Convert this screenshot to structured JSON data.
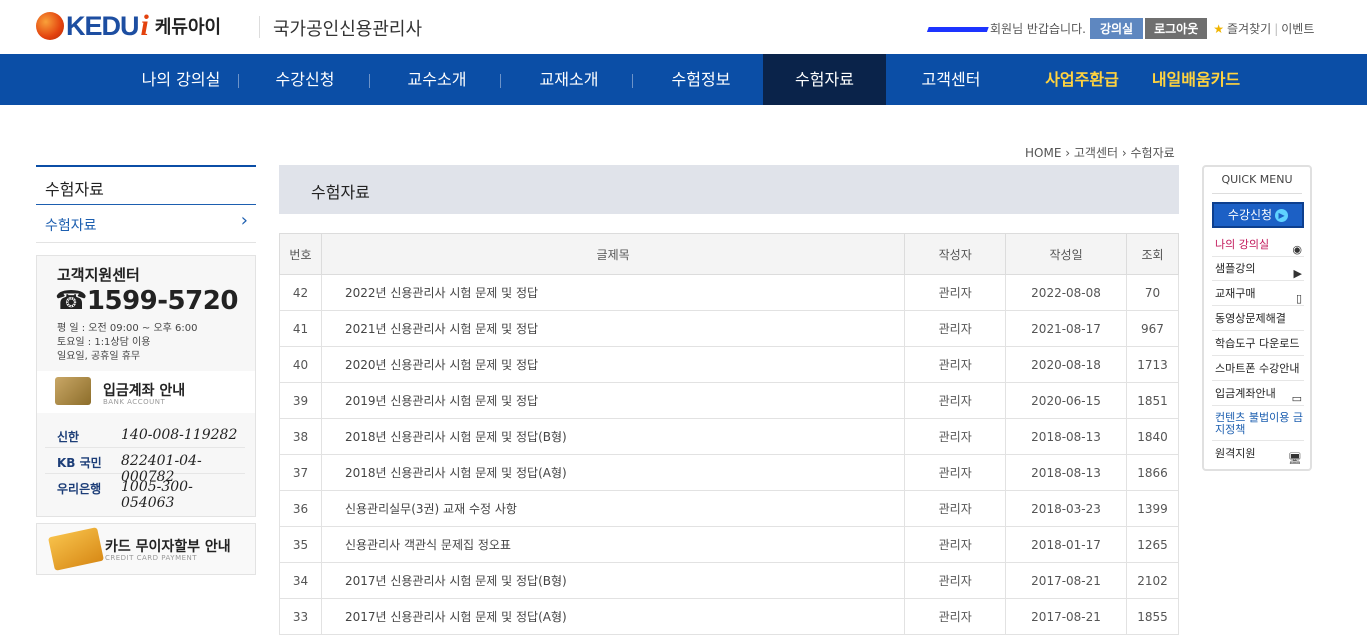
{
  "header": {
    "logo_text": "KEDU",
    "logo_i": "i",
    "logo_kr": "케듀아이",
    "site_subtitle": "국가공인신용관리사",
    "greeting": "회원님 반갑습니다.",
    "classroom_btn": "강의실",
    "logout_btn": "로그아웃",
    "bookmark": "즐겨찾기",
    "event": "이벤트"
  },
  "nav": {
    "items": [
      "나의 강의실",
      "수강신청",
      "교수소개",
      "교재소개",
      "수험정보",
      "수험자료",
      "고객센터",
      "사업주환급",
      "내일배움카드"
    ],
    "active_index": 5
  },
  "breadcrumb": [
    "HOME",
    "고객센터",
    "수험자료"
  ],
  "sidebar": {
    "title": "수험자료",
    "items": [
      {
        "label": "수험자료"
      }
    ],
    "cs_title": "고객지원센터",
    "cs_phone": "☎1599-5720",
    "cs_hours": [
      "평  일  :  오전 09:00 ~ 오후 6:00",
      "토요일  :  1:1상담 이용",
      "일요일, 공휴일 휴무"
    ],
    "bank_title": "입금계좌 안내",
    "bank_sub": "BANK ACCOUNT",
    "banks": [
      {
        "name": "신한",
        "account": "140-008-119282"
      },
      {
        "name": "KB 국민",
        "account": "822401-04-000782"
      },
      {
        "name": "우리은행",
        "account": "1005-300-054063"
      }
    ],
    "card_title": "카드 무이자할부 안내",
    "card_sub": "CREDIT CARD PAYMENT"
  },
  "content": {
    "title": "수험자료",
    "columns": [
      "번호",
      "글제목",
      "작성자",
      "작성일",
      "조회"
    ],
    "rows": [
      {
        "no": "42",
        "subject": "2022년 신용관리사 시험 문제 및 정답",
        "author": "관리자",
        "date": "2022-08-08",
        "views": "70"
      },
      {
        "no": "41",
        "subject": "2021년 신용관리사 시험 문제 및 정답",
        "author": "관리자",
        "date": "2021-08-17",
        "views": "967"
      },
      {
        "no": "40",
        "subject": "2020년 신용관리사 시험 문제 및 정답",
        "author": "관리자",
        "date": "2020-08-18",
        "views": "1713"
      },
      {
        "no": "39",
        "subject": "2019년 신용관리사 시험 문제 및 정답",
        "author": "관리자",
        "date": "2020-06-15",
        "views": "1851"
      },
      {
        "no": "38",
        "subject": "2018년 신용관리사 시험 문제 및 정답(B형)",
        "author": "관리자",
        "date": "2018-08-13",
        "views": "1840"
      },
      {
        "no": "37",
        "subject": "2018년 신용관리사 시험 문제 및 정답(A형)",
        "author": "관리자",
        "date": "2018-08-13",
        "views": "1866"
      },
      {
        "no": "36",
        "subject": "신용관리실무(3권) 교재 수정 사항",
        "author": "관리자",
        "date": "2018-03-23",
        "views": "1399"
      },
      {
        "no": "35",
        "subject": "신용관리사 객관식 문제집 정오표",
        "author": "관리자",
        "date": "2018-01-17",
        "views": "1265"
      },
      {
        "no": "34",
        "subject": "2017년 신용관리사 시험 문제 및 정답(B형)",
        "author": "관리자",
        "date": "2017-08-21",
        "views": "2102"
      },
      {
        "no": "33",
        "subject": "2017년 신용관리사 시험 문제 및 정답(A형)",
        "author": "관리자",
        "date": "2017-08-21",
        "views": "1855"
      }
    ]
  },
  "quick_menu": {
    "title": "QUICK MENU",
    "button": "수강신청",
    "items": [
      {
        "label": "나의 강의실",
        "icon": "user-icon",
        "glyph": "◉"
      },
      {
        "label": "샘플강의",
        "icon": "play-icon",
        "glyph": "▶"
      },
      {
        "label": "교재구매",
        "icon": "book-icon",
        "glyph": "▯"
      },
      {
        "label": "동영상문제해결",
        "icon": "",
        "glyph": ""
      },
      {
        "label": "학습도구 다운로드",
        "icon": "",
        "glyph": ""
      },
      {
        "label": "스마트폰 수강안내",
        "icon": "",
        "glyph": ""
      },
      {
        "label": "입금계좌안내",
        "icon": "card-icon",
        "glyph": "▭"
      },
      {
        "label": "컨텐츠 불법이용 금지정책",
        "icon": "",
        "glyph": ""
      },
      {
        "label": "원격지원",
        "icon": "monitor-icon",
        "glyph": "🖥"
      }
    ]
  }
}
